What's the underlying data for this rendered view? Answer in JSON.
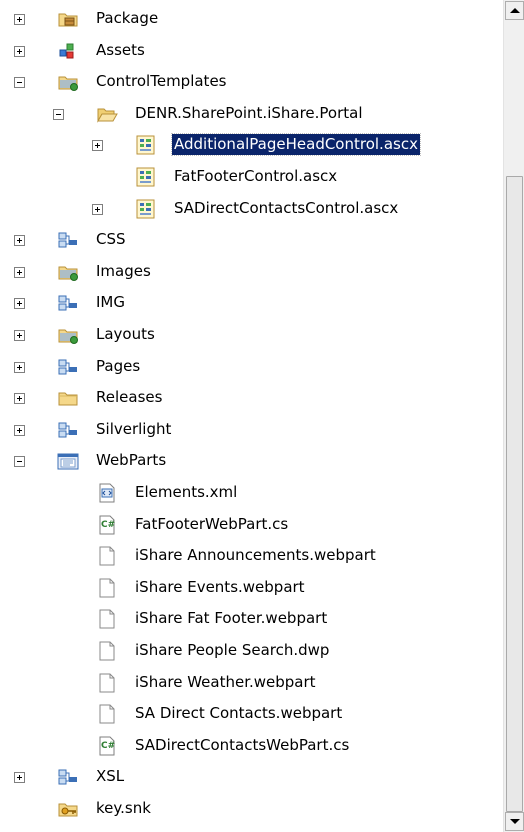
{
  "tree": {
    "items": [
      {
        "label": "Package",
        "icon": "package-icon",
        "expander": "plus",
        "level": 0,
        "selected": false
      },
      {
        "label": "Assets",
        "icon": "assets-icon",
        "expander": "plus",
        "level": 0,
        "selected": false
      },
      {
        "label": "ControlTemplates",
        "icon": "special-folder-icon",
        "expander": "minus",
        "level": 0,
        "selected": false
      },
      {
        "label": "DENR.SharePoint.iShare.Portal",
        "icon": "folder-open-icon",
        "expander": "minus",
        "level": 1,
        "selected": false
      },
      {
        "label": "AdditionalPageHeadControl.ascx",
        "icon": "ascx-file-icon",
        "expander": "plus",
        "level": 2,
        "selected": true
      },
      {
        "label": "FatFooterControl.ascx",
        "icon": "ascx-file-icon",
        "expander": "none",
        "level": 2,
        "selected": false
      },
      {
        "label": "SADirectContactsControl.ascx",
        "icon": "ascx-file-icon",
        "expander": "plus",
        "level": 2,
        "selected": false
      },
      {
        "label": "CSS",
        "icon": "mapped-folder-icon",
        "expander": "plus",
        "level": 0,
        "selected": false
      },
      {
        "label": "Images",
        "icon": "special-folder-icon",
        "expander": "plus",
        "level": 0,
        "selected": false
      },
      {
        "label": "IMG",
        "icon": "mapped-folder-icon",
        "expander": "plus",
        "level": 0,
        "selected": false
      },
      {
        "label": "Layouts",
        "icon": "special-folder-icon",
        "expander": "plus",
        "level": 0,
        "selected": false
      },
      {
        "label": "Pages",
        "icon": "mapped-folder-icon",
        "expander": "plus",
        "level": 0,
        "selected": false
      },
      {
        "label": "Releases",
        "icon": "folder-icon",
        "expander": "plus",
        "level": 0,
        "selected": false
      },
      {
        "label": "Silverlight",
        "icon": "mapped-folder-icon",
        "expander": "plus",
        "level": 0,
        "selected": false
      },
      {
        "label": "WebParts",
        "icon": "webparts-icon",
        "expander": "minus",
        "level": 0,
        "selected": false
      },
      {
        "label": "Elements.xml",
        "icon": "xml-file-icon",
        "expander": "none",
        "level": 1,
        "selected": false
      },
      {
        "label": "FatFooterWebPart.cs",
        "icon": "csharp-file-icon",
        "expander": "none",
        "level": 1,
        "selected": false
      },
      {
        "label": "iShare Announcements.webpart",
        "icon": "document-icon",
        "expander": "none",
        "level": 1,
        "selected": false
      },
      {
        "label": "iShare Events.webpart",
        "icon": "document-icon",
        "expander": "none",
        "level": 1,
        "selected": false
      },
      {
        "label": "iShare Fat Footer.webpart",
        "icon": "document-icon",
        "expander": "none",
        "level": 1,
        "selected": false
      },
      {
        "label": "iShare People Search.dwp",
        "icon": "document-icon",
        "expander": "none",
        "level": 1,
        "selected": false
      },
      {
        "label": "iShare Weather.webpart",
        "icon": "document-icon",
        "expander": "none",
        "level": 1,
        "selected": false
      },
      {
        "label": "SA Direct Contacts.webpart",
        "icon": "document-icon",
        "expander": "none",
        "level": 1,
        "selected": false
      },
      {
        "label": "SADirectContactsWebPart.cs",
        "icon": "csharp-file-icon",
        "expander": "none",
        "level": 1,
        "selected": false
      },
      {
        "label": "XSL",
        "icon": "mapped-folder-icon",
        "expander": "plus",
        "level": 0,
        "selected": false
      },
      {
        "label": "key.snk",
        "icon": "key-file-icon",
        "expander": "none",
        "level": 0,
        "selected": false
      }
    ]
  },
  "scrollbar": {
    "position": 0.2
  },
  "colors": {
    "selection": "#0a246a",
    "folder": "#f5d88a",
    "scrollbar": "#f0f0f0"
  }
}
